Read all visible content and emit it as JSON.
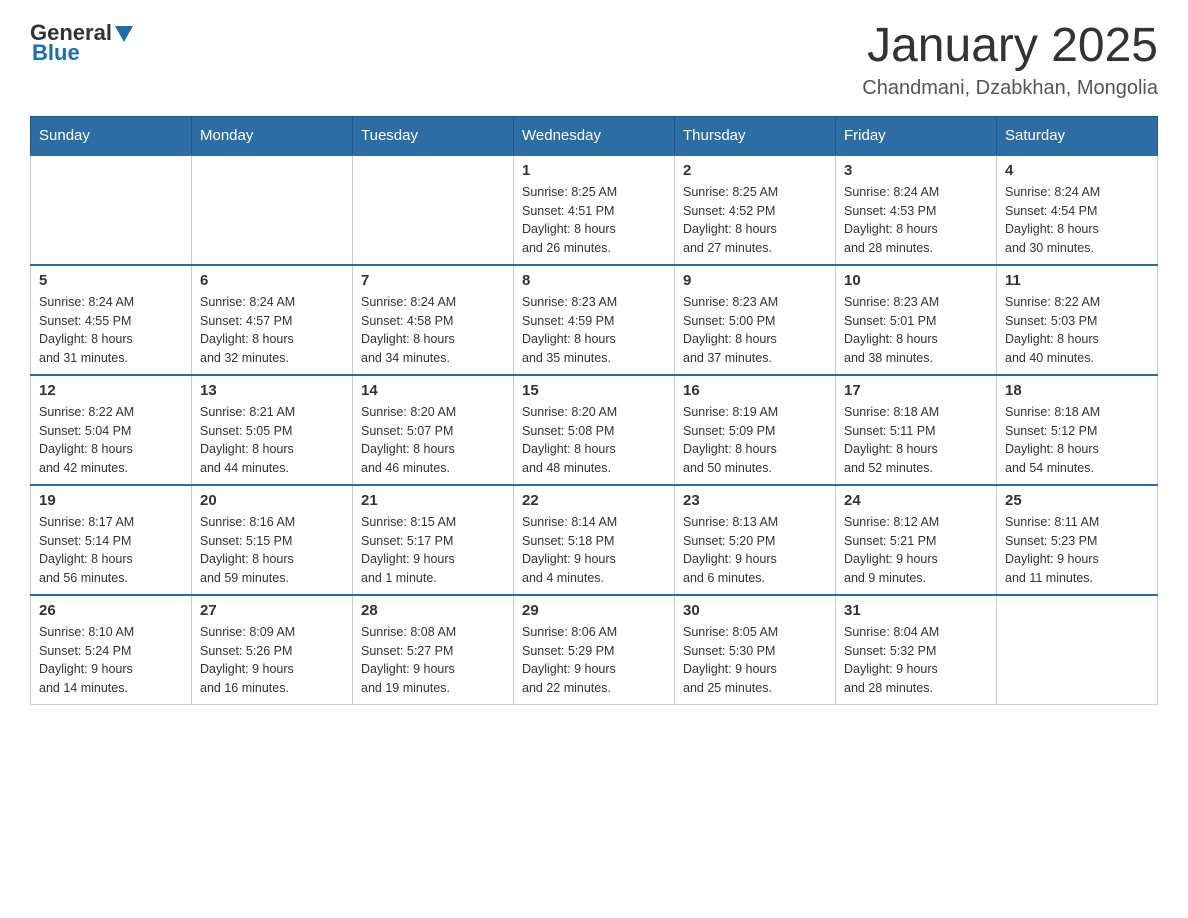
{
  "header": {
    "logo": {
      "general": "General",
      "blue": "Blue"
    },
    "title": "January 2025",
    "location": "Chandmani, Dzabkhan, Mongolia"
  },
  "days_of_week": [
    "Sunday",
    "Monday",
    "Tuesday",
    "Wednesday",
    "Thursday",
    "Friday",
    "Saturday"
  ],
  "weeks": [
    [
      {
        "day": "",
        "info": ""
      },
      {
        "day": "",
        "info": ""
      },
      {
        "day": "",
        "info": ""
      },
      {
        "day": "1",
        "info": "Sunrise: 8:25 AM\nSunset: 4:51 PM\nDaylight: 8 hours\nand 26 minutes."
      },
      {
        "day": "2",
        "info": "Sunrise: 8:25 AM\nSunset: 4:52 PM\nDaylight: 8 hours\nand 27 minutes."
      },
      {
        "day": "3",
        "info": "Sunrise: 8:24 AM\nSunset: 4:53 PM\nDaylight: 8 hours\nand 28 minutes."
      },
      {
        "day": "4",
        "info": "Sunrise: 8:24 AM\nSunset: 4:54 PM\nDaylight: 8 hours\nand 30 minutes."
      }
    ],
    [
      {
        "day": "5",
        "info": "Sunrise: 8:24 AM\nSunset: 4:55 PM\nDaylight: 8 hours\nand 31 minutes."
      },
      {
        "day": "6",
        "info": "Sunrise: 8:24 AM\nSunset: 4:57 PM\nDaylight: 8 hours\nand 32 minutes."
      },
      {
        "day": "7",
        "info": "Sunrise: 8:24 AM\nSunset: 4:58 PM\nDaylight: 8 hours\nand 34 minutes."
      },
      {
        "day": "8",
        "info": "Sunrise: 8:23 AM\nSunset: 4:59 PM\nDaylight: 8 hours\nand 35 minutes."
      },
      {
        "day": "9",
        "info": "Sunrise: 8:23 AM\nSunset: 5:00 PM\nDaylight: 8 hours\nand 37 minutes."
      },
      {
        "day": "10",
        "info": "Sunrise: 8:23 AM\nSunset: 5:01 PM\nDaylight: 8 hours\nand 38 minutes."
      },
      {
        "day": "11",
        "info": "Sunrise: 8:22 AM\nSunset: 5:03 PM\nDaylight: 8 hours\nand 40 minutes."
      }
    ],
    [
      {
        "day": "12",
        "info": "Sunrise: 8:22 AM\nSunset: 5:04 PM\nDaylight: 8 hours\nand 42 minutes."
      },
      {
        "day": "13",
        "info": "Sunrise: 8:21 AM\nSunset: 5:05 PM\nDaylight: 8 hours\nand 44 minutes."
      },
      {
        "day": "14",
        "info": "Sunrise: 8:20 AM\nSunset: 5:07 PM\nDaylight: 8 hours\nand 46 minutes."
      },
      {
        "day": "15",
        "info": "Sunrise: 8:20 AM\nSunset: 5:08 PM\nDaylight: 8 hours\nand 48 minutes."
      },
      {
        "day": "16",
        "info": "Sunrise: 8:19 AM\nSunset: 5:09 PM\nDaylight: 8 hours\nand 50 minutes."
      },
      {
        "day": "17",
        "info": "Sunrise: 8:18 AM\nSunset: 5:11 PM\nDaylight: 8 hours\nand 52 minutes."
      },
      {
        "day": "18",
        "info": "Sunrise: 8:18 AM\nSunset: 5:12 PM\nDaylight: 8 hours\nand 54 minutes."
      }
    ],
    [
      {
        "day": "19",
        "info": "Sunrise: 8:17 AM\nSunset: 5:14 PM\nDaylight: 8 hours\nand 56 minutes."
      },
      {
        "day": "20",
        "info": "Sunrise: 8:16 AM\nSunset: 5:15 PM\nDaylight: 8 hours\nand 59 minutes."
      },
      {
        "day": "21",
        "info": "Sunrise: 8:15 AM\nSunset: 5:17 PM\nDaylight: 9 hours\nand 1 minute."
      },
      {
        "day": "22",
        "info": "Sunrise: 8:14 AM\nSunset: 5:18 PM\nDaylight: 9 hours\nand 4 minutes."
      },
      {
        "day": "23",
        "info": "Sunrise: 8:13 AM\nSunset: 5:20 PM\nDaylight: 9 hours\nand 6 minutes."
      },
      {
        "day": "24",
        "info": "Sunrise: 8:12 AM\nSunset: 5:21 PM\nDaylight: 9 hours\nand 9 minutes."
      },
      {
        "day": "25",
        "info": "Sunrise: 8:11 AM\nSunset: 5:23 PM\nDaylight: 9 hours\nand 11 minutes."
      }
    ],
    [
      {
        "day": "26",
        "info": "Sunrise: 8:10 AM\nSunset: 5:24 PM\nDaylight: 9 hours\nand 14 minutes."
      },
      {
        "day": "27",
        "info": "Sunrise: 8:09 AM\nSunset: 5:26 PM\nDaylight: 9 hours\nand 16 minutes."
      },
      {
        "day": "28",
        "info": "Sunrise: 8:08 AM\nSunset: 5:27 PM\nDaylight: 9 hours\nand 19 minutes."
      },
      {
        "day": "29",
        "info": "Sunrise: 8:06 AM\nSunset: 5:29 PM\nDaylight: 9 hours\nand 22 minutes."
      },
      {
        "day": "30",
        "info": "Sunrise: 8:05 AM\nSunset: 5:30 PM\nDaylight: 9 hours\nand 25 minutes."
      },
      {
        "day": "31",
        "info": "Sunrise: 8:04 AM\nSunset: 5:32 PM\nDaylight: 9 hours\nand 28 minutes."
      },
      {
        "day": "",
        "info": ""
      }
    ]
  ]
}
